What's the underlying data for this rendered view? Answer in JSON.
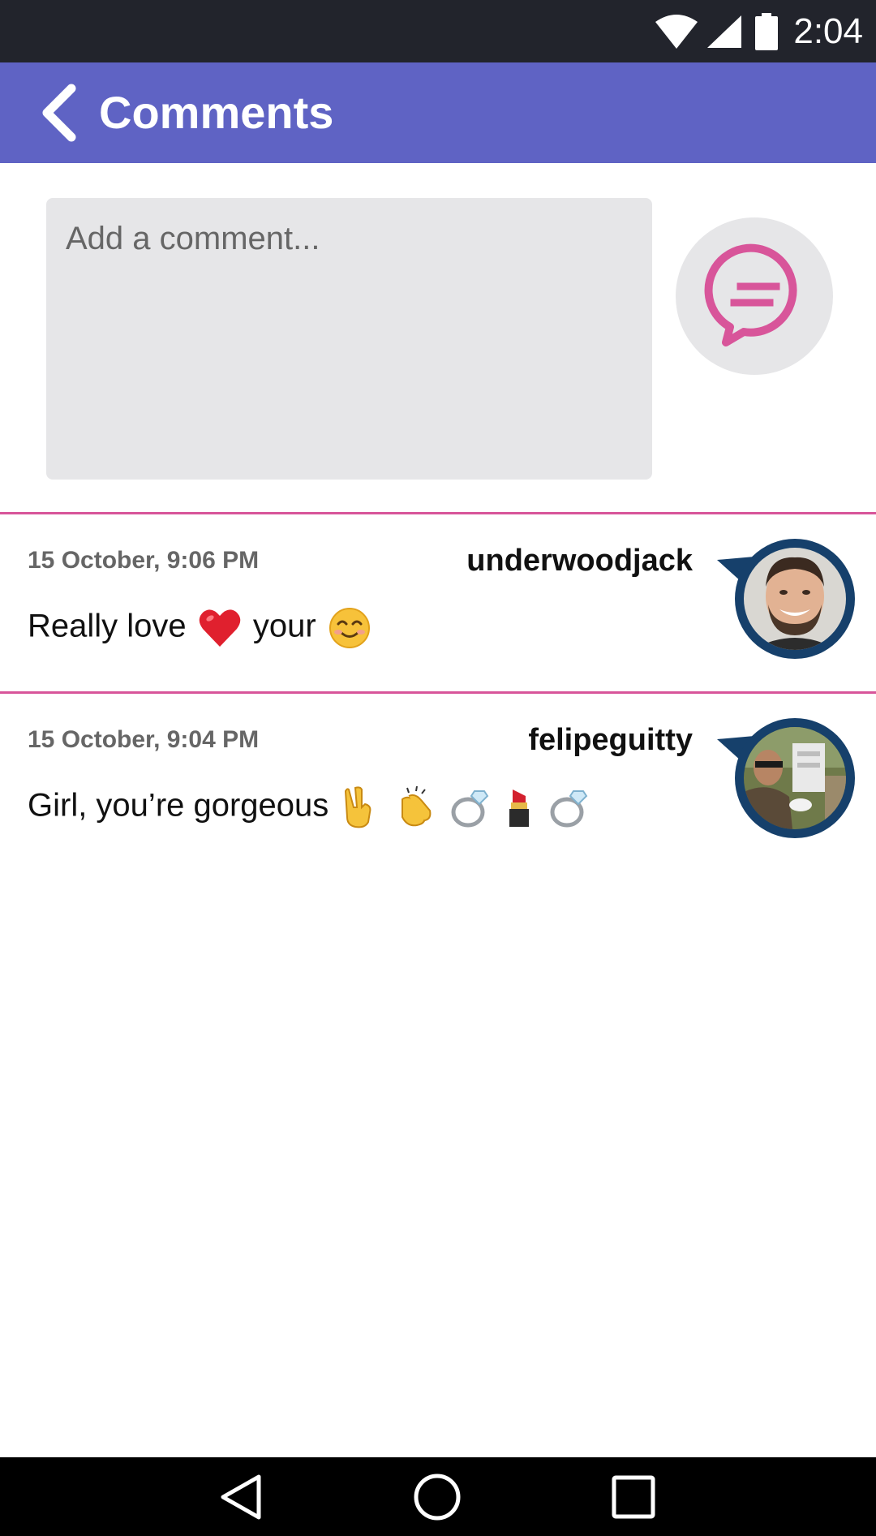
{
  "status_bar": {
    "time": "2:04"
  },
  "header": {
    "title": "Comments"
  },
  "composer": {
    "placeholder": "Add a comment..."
  },
  "comments": [
    {
      "timestamp": "15 October, 9:06 PM",
      "username": "underwoodjack",
      "text": "Really love",
      "text_after_heart": "your"
    },
    {
      "timestamp": "15 October, 9:04 PM",
      "username": "felipeguitty",
      "text": "Girl, you’re gorgeous"
    }
  ],
  "colors": {
    "status_bar": "#22242c",
    "app_bar": "#5f63c4",
    "accent": "#d8559a",
    "input_bg": "#e6e6e8",
    "avatar_ring": "#16406b"
  }
}
